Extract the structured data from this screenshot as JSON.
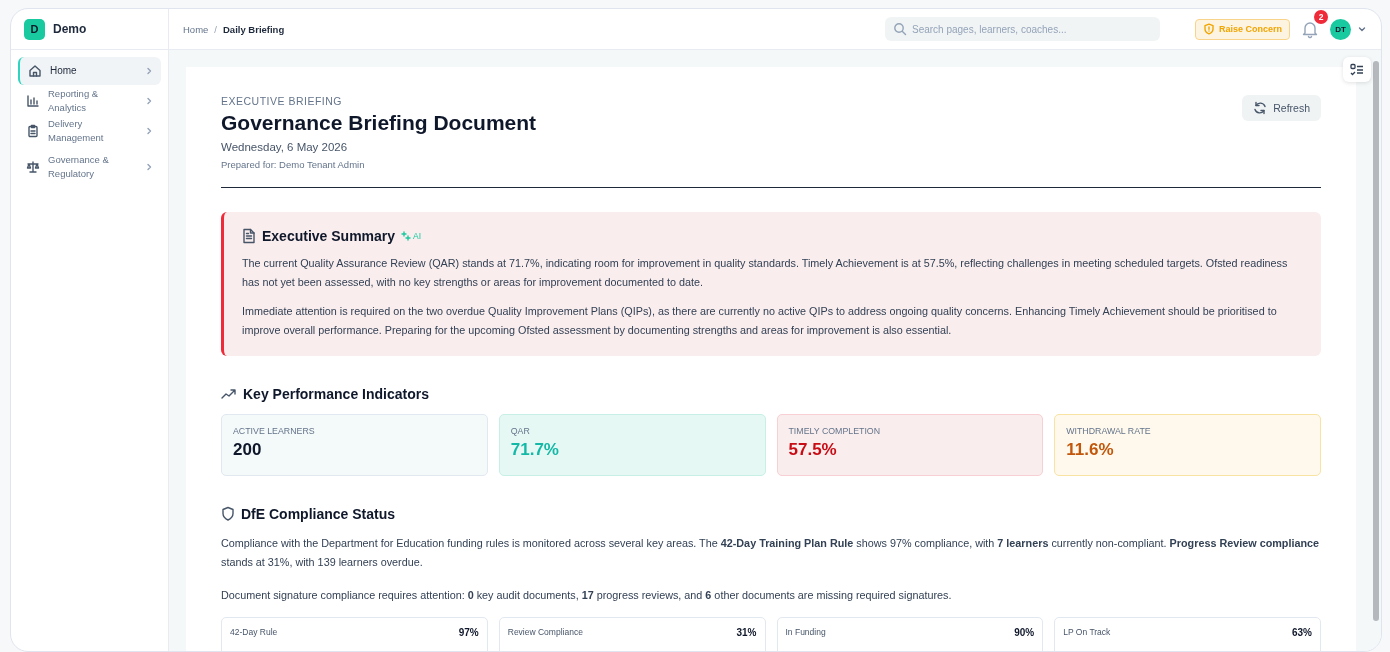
{
  "brand": {
    "logo": "D",
    "name": "Demo"
  },
  "sidebar": {
    "items": [
      {
        "label": "Home",
        "selected": true
      },
      {
        "label": "Reporting & Analytics",
        "selected": false
      },
      {
        "label": "Delivery Management",
        "selected": false
      },
      {
        "label": "Governance & Regulatory",
        "selected": false
      }
    ]
  },
  "header": {
    "breadcrumb": [
      "Home",
      "Daily Briefing"
    ],
    "breadcrumb_separator": "/",
    "search": {
      "placeholder": "Search pages, learners, coaches..."
    },
    "raise_button": "Raise Concern",
    "notifications": "2",
    "avatar": "DT"
  },
  "document": {
    "eyebrow": "EXECUTIVE BRIEFING",
    "title": "Governance Briefing Document",
    "date": "Wednesday, 6 May 2026",
    "prepared_for": "Prepared for: Demo Tenant Admin",
    "refresh_button": "Refresh",
    "summary": {
      "title": "Executive Summary",
      "badge": "AI",
      "paragraphs": [
        "The current Quality Assurance Review (QAR) stands at 71.7%, indicating room for improvement in quality standards. Timely Achievement is at 57.5%, reflecting challenges in meeting scheduled targets. Ofsted readiness has not yet been assessed, with no key strengths or areas for improvement documented to date.",
        "Immediate attention is required on the two overdue Quality Improvement Plans (QIPs), as there are currently no active QIPs to address ongoing quality concerns. Enhancing Timely Achievement should be prioritised to improve overall performance. Preparing for the upcoming Ofsted assessment by documenting strengths and areas for improvement is also essential."
      ]
    },
    "kpi": {
      "title": "Key Performance Indicators",
      "cards": [
        {
          "kind": "neutral",
          "label": "ACTIVE LEARNERS",
          "value": "200"
        },
        {
          "kind": "good",
          "label": "QAR",
          "value": "71.7%"
        },
        {
          "kind": "bad",
          "label": "TIMELY COMPLETION",
          "value": "57.5%"
        },
        {
          "kind": "warn",
          "label": "WITHDRAWAL RATE",
          "value": "11.6%"
        }
      ]
    },
    "compliance": {
      "title": "DfE Compliance Status",
      "paragraphs": [
        "Compliance with the Department for Education funding rules is monitored across several key areas. The **42-Day Training Plan Rule** shows 97% compliance, with **7 learners** currently non-compliant. **Progress Review compliance** stands at 31%, with 139 learners overdue.",
        "Document signature compliance requires attention: **0** key audit documents, **17** progress reviews, and **6** other documents are missing required signatures."
      ],
      "cards": [
        {
          "label": "42-Day Rule",
          "value": "97%"
        },
        {
          "label": "Review Compliance",
          "value": "31%"
        },
        {
          "label": "In Funding",
          "value": "90%"
        },
        {
          "label": "LP On Track",
          "value": "63%"
        }
      ]
    }
  }
}
